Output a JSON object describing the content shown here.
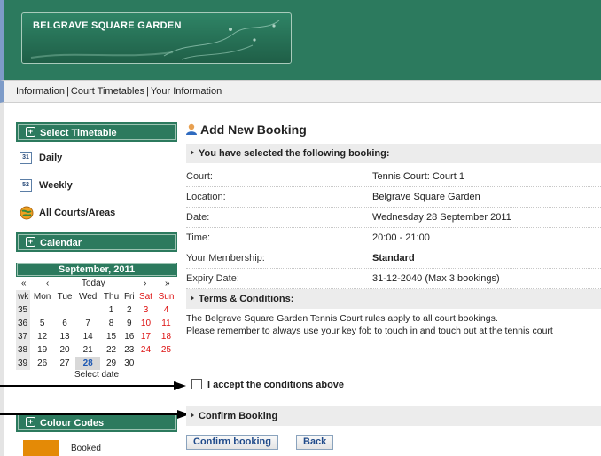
{
  "header": {
    "logo_text": "BELGRAVE SQUARE GARDEN"
  },
  "nav": {
    "items": [
      "Information",
      "Court Timetables",
      "Your Information"
    ],
    "separator": "|"
  },
  "sidebar": {
    "select_timetable": "Select Timetable",
    "items": [
      {
        "label": "Daily",
        "icon": "31"
      },
      {
        "label": "Weekly",
        "icon": "52"
      },
      {
        "label": "All Courts/Areas"
      }
    ],
    "calendar_heading": "Calendar",
    "colour_codes": "Colour Codes",
    "booked_label": "Booked",
    "booked_color": "#e48a06"
  },
  "calendar": {
    "month": "September, 2011",
    "nav": {
      "prev_year": "«",
      "prev_month": "‹",
      "today": "Today",
      "next_month": "›",
      "next_year": "»"
    },
    "headers": [
      "wk",
      "Mon",
      "Tue",
      "Wed",
      "Thu",
      "Fri",
      "Sat",
      "Sun"
    ],
    "weeks": [
      [
        "35",
        "",
        "",
        "",
        "1",
        "2",
        "3",
        "4"
      ],
      [
        "36",
        "5",
        "6",
        "7",
        "8",
        "9",
        "10",
        "11"
      ],
      [
        "37",
        "12",
        "13",
        "14",
        "15",
        "16",
        "17",
        "18"
      ],
      [
        "38",
        "19",
        "20",
        "21",
        "22",
        "23",
        "24",
        "25"
      ],
      [
        "39",
        "26",
        "27",
        "28",
        "29",
        "30",
        "",
        ""
      ]
    ],
    "selected_day": "28",
    "footer": "Select date"
  },
  "main": {
    "title": "Add New Booking",
    "selected_heading": "You have selected the following booking:",
    "details": [
      {
        "key": "Court:",
        "value": "Tennis Court: Court 1"
      },
      {
        "key": "Location:",
        "value": "Belgrave Square Garden"
      },
      {
        "key": "Date:",
        "value": "Wednesday 28 September 2011"
      },
      {
        "key": "Time:",
        "value": "20:00 - 21:00"
      },
      {
        "key": "Your Membership:",
        "value": "Standard"
      },
      {
        "key": "Expiry Date:",
        "value": "31-12-2040 (Max 3 bookings)"
      }
    ],
    "terms_heading": "Terms & Conditions:",
    "terms_line1": "The Belgrave Square Garden Tennis Court rules apply to all court bookings.",
    "terms_line2": "Please remember to always use your key fob to touch in and touch out at the tennis court",
    "accept_label": "I accept the conditions above",
    "confirm_heading": "Confirm Booking",
    "confirm_button": "Confirm booking",
    "back_button": "Back"
  },
  "colors": {
    "brand_green": "#2c7a5e",
    "weekend_red": "#dd1111",
    "link_blue": "#1f4a8a"
  }
}
